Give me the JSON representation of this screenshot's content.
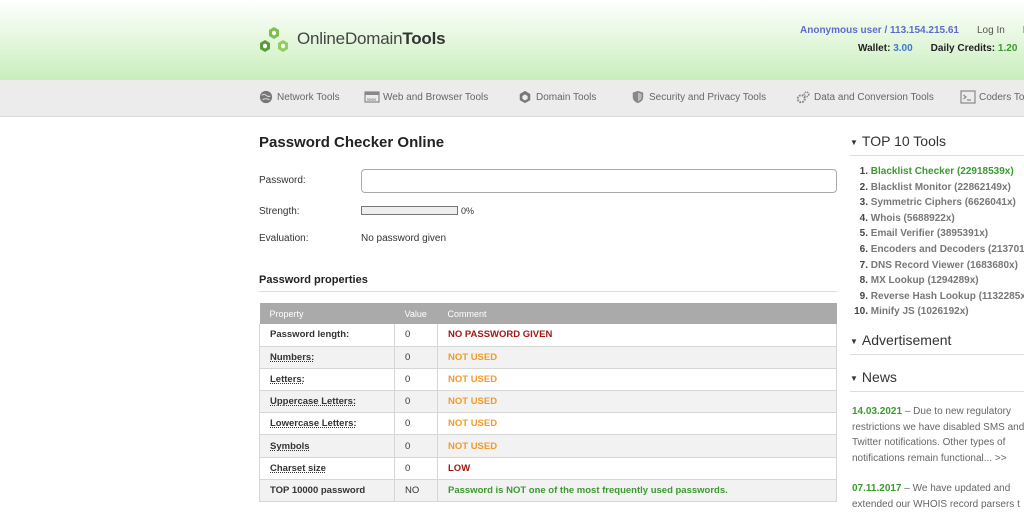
{
  "header": {
    "logo_prefix": "OnlineDomain",
    "logo_bold": "Tools",
    "user": "Anonymous user / 113.154.215.61",
    "login": "Log In",
    "register": "Re",
    "wallet_label": "Wallet:",
    "wallet_value": "3.00",
    "credits_label": "Daily Credits:",
    "credits_value": "1.20"
  },
  "nav": {
    "items": [
      {
        "label": "Network Tools",
        "icon": "globe-icon"
      },
      {
        "label": "Web and Browser Tools",
        "icon": "browser-icon"
      },
      {
        "label": "Domain Tools",
        "icon": "hexagon-icon"
      },
      {
        "label": "Security and Privacy Tools",
        "icon": "shield-icon"
      },
      {
        "label": "Data and Conversion Tools",
        "icon": "gears-icon"
      },
      {
        "label": "Coders To",
        "icon": "terminal-icon"
      }
    ]
  },
  "page": {
    "title": "Password Checker Online",
    "password_label": "Password:",
    "password_value": "",
    "strength_label": "Strength:",
    "strength_value": 0,
    "strength_pct": "0%",
    "evaluation_label": "Evaluation:",
    "evaluation_value": "No password given",
    "properties_title": "Password properties"
  },
  "table": {
    "headers": [
      "Property",
      "Value",
      "Comment"
    ],
    "rows": [
      {
        "property": "Password length:",
        "value": "0",
        "comment": "NO PASSWORD GIVEN",
        "status": "red",
        "link": false
      },
      {
        "property": "Numbers:",
        "value": "0",
        "comment": "NOT USED",
        "status": "orange",
        "link": true
      },
      {
        "property": "Letters:",
        "value": "0",
        "comment": "NOT USED",
        "status": "orange",
        "link": true
      },
      {
        "property": "Uppercase Letters:",
        "value": "0",
        "comment": "NOT USED",
        "status": "orange",
        "link": true
      },
      {
        "property": "Lowercase Letters:",
        "value": "0",
        "comment": "NOT USED",
        "status": "orange",
        "link": true
      },
      {
        "property": "Symbols",
        "value": "0",
        "comment": "NOT USED",
        "status": "orange",
        "link": true
      },
      {
        "property": "Charset size",
        "value": "0",
        "comment": "LOW",
        "status": "red",
        "link": true
      },
      {
        "property": "TOP 10000 password",
        "value": "NO",
        "comment": "Password is NOT one of the most frequently used passwords.",
        "status": "green",
        "link": false
      }
    ]
  },
  "sidebar": {
    "top_title": "TOP 10 Tools",
    "top_tools": [
      {
        "num": "1.",
        "label": "Blacklist Checker (22918539x)"
      },
      {
        "num": "2.",
        "label": "Blacklist Monitor (22862149x)"
      },
      {
        "num": "3.",
        "label": "Symmetric Ciphers (6626041x)"
      },
      {
        "num": "4.",
        "label": "Whois (5688922x)"
      },
      {
        "num": "5.",
        "label": "Email Verifier (3895391x)"
      },
      {
        "num": "6.",
        "label": "Encoders and Decoders (213701"
      },
      {
        "num": "7.",
        "label": "DNS Record Viewer (1683680x)"
      },
      {
        "num": "8.",
        "label": "MX Lookup (1294289x)"
      },
      {
        "num": "9.",
        "label": "Reverse Hash Lookup (1132285x"
      },
      {
        "num": "10.",
        "label": "Minify JS (1026192x)"
      }
    ],
    "ad_title": "Advertisement",
    "news_title": "News",
    "news": [
      {
        "date": "14.03.2021",
        "text": " – Due to new regulatory restrictions we have disabled SMS and Twitter notifications. Other types of notifications remain functional... >>"
      },
      {
        "date": "07.11.2017",
        "text": " – We have updated and extended our WHOIS record parsers t"
      }
    ]
  },
  "colors": {
    "header_green": "#c9eebd",
    "accent_green": "#3a9a2e",
    "link_blue": "#5b6ccc",
    "warn_orange": "#f29a2b",
    "error_red": "#a01818"
  }
}
